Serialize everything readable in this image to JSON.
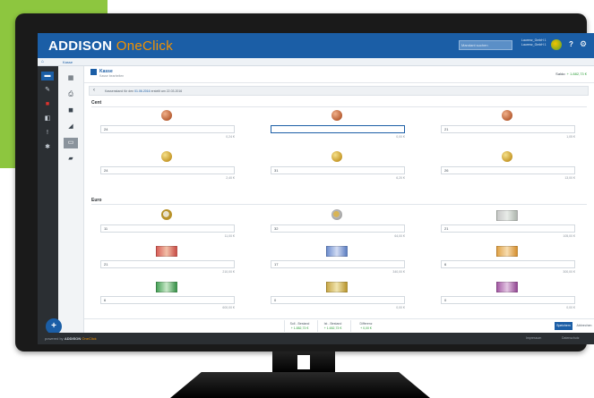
{
  "app": {
    "brand_main": "ADDISON",
    "brand_sub": "OneClick",
    "search_placeholder": "Mandant suchen",
    "user_line1": "Laurenz_GmbH 1",
    "user_line2": "Laurenz_GmbH 1",
    "help_label": "?"
  },
  "breadcrumb": {
    "text": "Kasse"
  },
  "page": {
    "title": "Kasse",
    "subtitle": "Kasse bearbeiten",
    "saldo_label": "Saldo:",
    "saldo_value": "+ 1.882,73 €"
  },
  "infobar": {
    "back": "‹",
    "text_before": "Kassenstand für den",
    "date": "01.06.2016",
    "text_after": "erstellt am 22.03.2016"
  },
  "sections": {
    "coins_title": "Cent",
    "notes_title": "Euro"
  },
  "coins": [
    {
      "value": "24",
      "sum": "0,24 €",
      "type": "copper"
    },
    {
      "value": "",
      "sum": "0,00 €",
      "type": "copper"
    },
    {
      "value": "21",
      "sum": "1,05 €",
      "type": "copper"
    },
    {
      "value": "24",
      "sum": "2,40 €",
      "type": "gold"
    },
    {
      "value": "31",
      "sum": "6,20 €",
      "type": "gold"
    },
    {
      "value": "26",
      "sum": "13,00 €",
      "type": "gold"
    }
  ],
  "notes": [
    {
      "value": "11",
      "sum": "11,00 €",
      "type": "bi1"
    },
    {
      "value": "32",
      "sum": "64,00 €",
      "type": "bi2"
    },
    {
      "value": "21",
      "sum": "105,00 €",
      "type": "n5"
    },
    {
      "value": "21",
      "sum": "210,00 €",
      "type": "n10"
    },
    {
      "value": "17",
      "sum": "340,00 €",
      "type": "n20"
    },
    {
      "value": "6",
      "sum": "300,00 €",
      "type": "n50"
    },
    {
      "value": "6",
      "sum": "600,00 €",
      "type": "n100"
    },
    {
      "value": "0",
      "sum": "0,00 €",
      "type": "n200"
    },
    {
      "value": "0",
      "sum": "0,00 €",
      "type": "n500"
    }
  ],
  "footer": {
    "soll_label": "Soll - Bestand",
    "soll_value": "+ 1.882,73 €",
    "ist_label": "Ist - Bestand",
    "ist_value": "+ 1.652,73 €",
    "diff_label": "Differenz",
    "diff_value": "+ 0,00 €",
    "save": "Speichern",
    "cancel": "Abbrechen"
  },
  "status": {
    "prefix": "powered by",
    "brand_main": "ADDISON",
    "brand_sub": "OneClick",
    "right1": "Impressum",
    "right2": "Datenschutz"
  },
  "colors": {
    "accent": "#1b5ea6",
    "brand_orange": "#f39200",
    "positive": "#2e9e3a",
    "backdrop_green": "#8dc63f"
  }
}
